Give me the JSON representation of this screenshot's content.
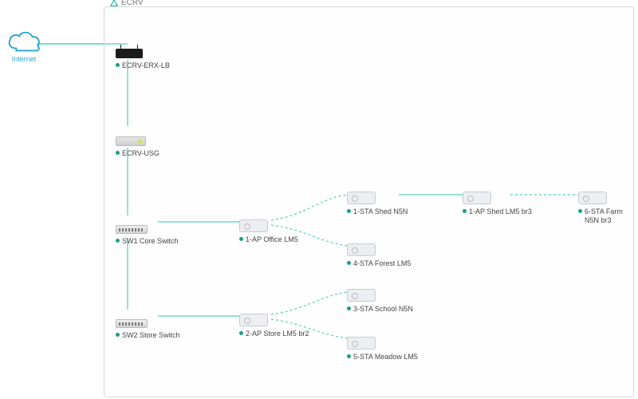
{
  "site": {
    "name": "ECRV"
  },
  "internet": {
    "label": "Internet"
  },
  "nodes": {
    "router": {
      "label": "ECRV-ERX-LB",
      "status": "up"
    },
    "usg": {
      "label": "ECRV-USG",
      "status": "up"
    },
    "sw1": {
      "label": "SW1 Core Switch",
      "status": "up"
    },
    "sw2": {
      "label": "SW2 Store Switch",
      "status": "up"
    },
    "ap1": {
      "label": "1-AP Office LM5",
      "status": "up"
    },
    "ap2": {
      "label": "2-AP Store LM5 br2",
      "status": "up"
    },
    "sta1": {
      "label": "1-STA Shed N5N",
      "status": "up"
    },
    "sta4": {
      "label": "4-STA Forest LM5",
      "status": "up"
    },
    "sta3": {
      "label": "3-STA School N5N",
      "status": "up"
    },
    "sta5": {
      "label": "5-STA Meadow LM5",
      "status": "up"
    },
    "ap_shed": {
      "label": "1-AP Shed LM5 br3",
      "status": "up"
    },
    "sta6": {
      "label": "6-STA Farm N5N br3",
      "status": "up"
    }
  },
  "edges": [
    {
      "from": "internet",
      "to": "router",
      "type": "solid"
    },
    {
      "from": "router",
      "to": "usg",
      "type": "solid"
    },
    {
      "from": "usg",
      "to": "sw1",
      "type": "solid"
    },
    {
      "from": "sw1",
      "to": "sw2",
      "type": "solid"
    },
    {
      "from": "sw1",
      "to": "ap1",
      "type": "solid"
    },
    {
      "from": "sw2",
      "to": "ap2",
      "type": "solid"
    },
    {
      "from": "ap1",
      "to": "sta1",
      "type": "dashed"
    },
    {
      "from": "ap1",
      "to": "sta4",
      "type": "dashed"
    },
    {
      "from": "ap2",
      "to": "sta3",
      "type": "dashed"
    },
    {
      "from": "ap2",
      "to": "sta5",
      "type": "dashed"
    },
    {
      "from": "sta1",
      "to": "ap_shed",
      "type": "solid"
    },
    {
      "from": "ap_shed",
      "to": "sta6",
      "type": "dashed"
    }
  ]
}
